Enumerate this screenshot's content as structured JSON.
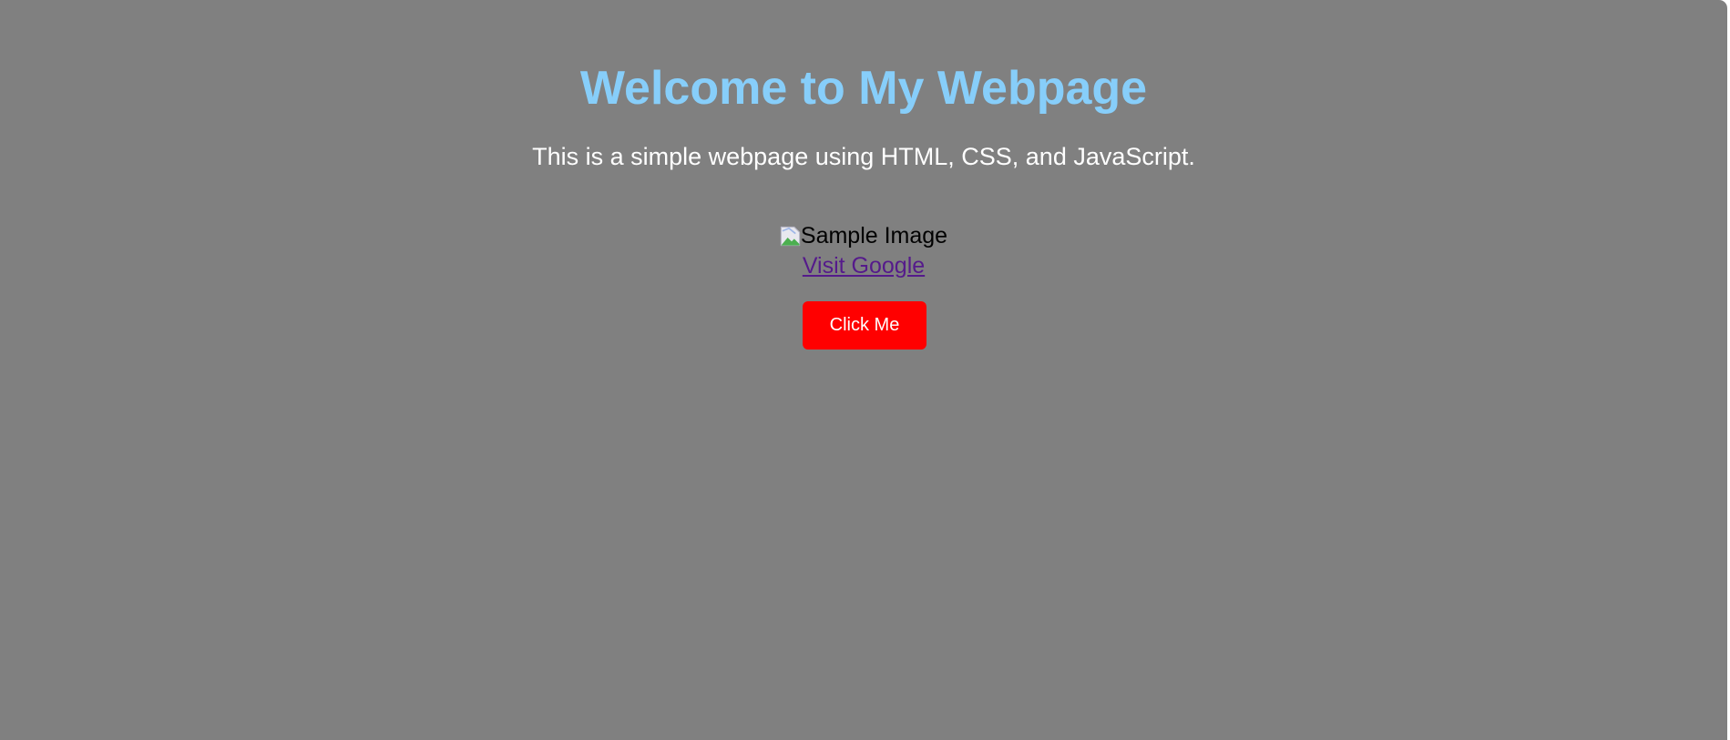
{
  "page": {
    "title": "Welcome to My Webpage",
    "subtitle": "This is a simple webpage using HTML, CSS, and JavaScript.",
    "background_color": "#808080",
    "title_color": "#87cefa"
  },
  "image": {
    "alt_text": "Sample Image",
    "icon": "broken-image-icon"
  },
  "link": {
    "label": "Visit Google",
    "color": "#551a8b"
  },
  "button": {
    "label": "Click Me",
    "color": "#ff0000"
  }
}
